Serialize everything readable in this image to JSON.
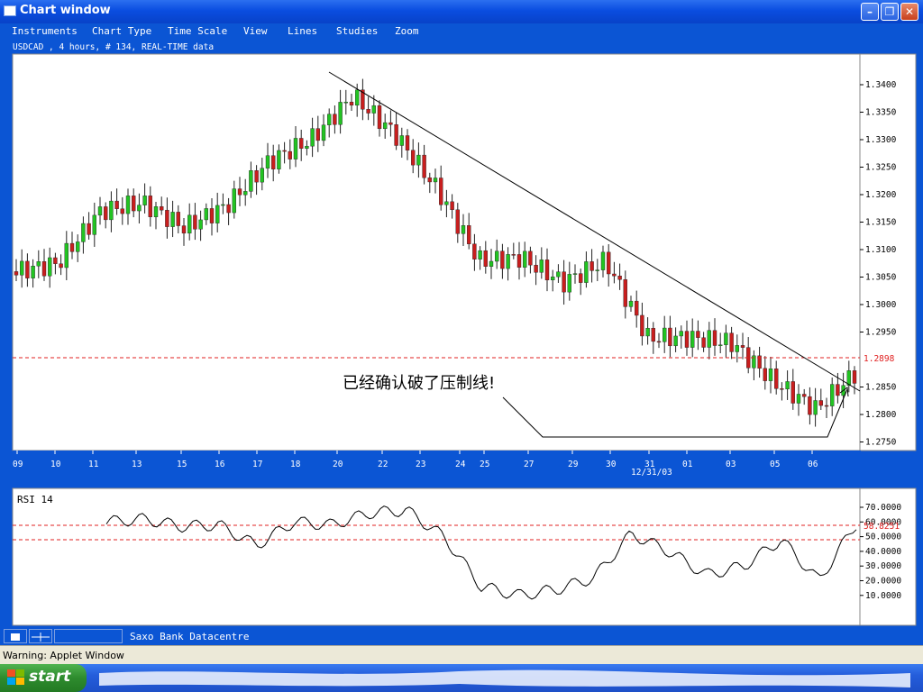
{
  "window": {
    "title": "Chart window"
  },
  "menu": [
    "Instruments",
    "Chart Type",
    "Time Scale",
    "View",
    "Lines",
    "Studies",
    "Zoom"
  ],
  "chart": {
    "info": "USDCAD , 4 hours, # 134, REAL-TIME data",
    "annotation": "已经确认破了压制线!",
    "current_price_label": "1.2898",
    "price_ticks": [
      "1.3400",
      "1.3350",
      "1.3300",
      "1.3250",
      "1.3200",
      "1.3150",
      "1.3100",
      "1.3050",
      "1.3000",
      "1.2950",
      "1.2850",
      "1.2800",
      "1.2750"
    ],
    "date_ticks": [
      "09",
      "10",
      "11",
      "13",
      "15",
      "16",
      "17",
      "18",
      "20",
      "22",
      "23",
      "24",
      "25",
      "27",
      "29",
      "30",
      "31",
      "01",
      "03",
      "05",
      "06"
    ],
    "date_label": "12/31/03"
  },
  "rsi": {
    "title": "RSI 14",
    "ticks": [
      "70.0000",
      "60.0000",
      "50.0000",
      "40.0000",
      "30.0000",
      "20.0000",
      "10.0000"
    ],
    "current_label": "58.8251"
  },
  "chart_data": [
    {
      "type": "candlestick",
      "title": "USDCAD , 4 hours, # 134, REAL-TIME data",
      "xlabel": "",
      "ylabel": "",
      "ylim": [
        1.272,
        1.345
      ],
      "x": [
        "09",
        "10",
        "11",
        "13",
        "15",
        "16",
        "17",
        "18",
        "20",
        "22",
        "23",
        "24",
        "25",
        "27",
        "29",
        "30",
        "31",
        "01",
        "03",
        "05",
        "06"
      ],
      "close": [
        1.306,
        1.3075,
        1.317,
        1.3185,
        1.314,
        1.318,
        1.326,
        1.33,
        1.338,
        1.331,
        1.321,
        1.308,
        1.3085,
        1.304,
        1.308,
        1.294,
        1.294,
        1.293,
        1.286,
        1.281,
        1.288
      ],
      "reference_lines": [
        {
          "name": "current",
          "value": 1.2898,
          "style": "dashed",
          "color": "#e02020"
        }
      ],
      "trendline": {
        "from": [
          "20",
          1.342
        ],
        "to": [
          "06",
          1.284
        ]
      },
      "colors": {
        "up": "#22c322",
        "down": "#c81e1e"
      }
    },
    {
      "type": "line",
      "title": "RSI 14",
      "x": [
        "09",
        "10",
        "11",
        "13",
        "15",
        "16",
        "17",
        "18",
        "20",
        "22",
        "23",
        "24",
        "25",
        "27",
        "29",
        "30",
        "31",
        "01",
        "03",
        "05",
        "06"
      ],
      "values": [
        60,
        62,
        57,
        58,
        44,
        60,
        58,
        66,
        68,
        50,
        16,
        10,
        14,
        22,
        52,
        40,
        24,
        30,
        48,
        20,
        58.8
      ],
      "ylim": [
        0,
        80
      ],
      "reference_lines": [
        {
          "value": 58.8251
        },
        {
          "value": 50
        }
      ],
      "color": "#000000"
    }
  ]
}
